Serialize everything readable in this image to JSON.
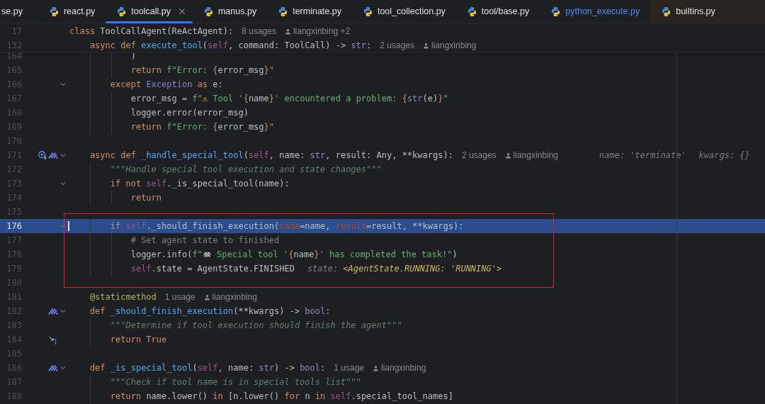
{
  "tabs": [
    {
      "label": "se.py",
      "kind": "project",
      "selected": false,
      "cut": true
    },
    {
      "label": "react.py",
      "kind": "project",
      "selected": false,
      "cut": false
    },
    {
      "label": "toolcall.py",
      "kind": "project",
      "selected": true,
      "cut": false
    },
    {
      "label": "manus.py",
      "kind": "project",
      "selected": false,
      "cut": false
    },
    {
      "label": "terminate.py",
      "kind": "project",
      "selected": false,
      "cut": false
    },
    {
      "label": "tool_collection.py",
      "kind": "project",
      "selected": false,
      "cut": false
    },
    {
      "label": "tool/base.py",
      "kind": "project",
      "selected": false,
      "cut": false
    },
    {
      "label": "python_execute.py",
      "kind": "changed",
      "selected": false,
      "cut": false
    },
    {
      "label": "builtins.py",
      "kind": "library",
      "selected": false,
      "cut": false
    }
  ],
  "sticky_lines": [
    {
      "number": "17",
      "tokens": [
        {
          "kind": "kw",
          "text": "class "
        },
        {
          "kind": "plain",
          "text": "ToolCallAgent(ReActAgent):"
        }
      ],
      "hints": [
        {
          "kind": "usages",
          "text": "8 usages"
        },
        {
          "kind": "author",
          "text": "liangxinbing +2"
        }
      ]
    },
    {
      "number": "132",
      "tokens": [
        {
          "kind": "kw",
          "text": "    async def "
        },
        {
          "kind": "fn",
          "text": "execute_tool"
        },
        {
          "kind": "plain",
          "text": "("
        },
        {
          "kind": "self",
          "text": "self"
        },
        {
          "kind": "plain",
          "text": ", command: ToolCall) -> "
        },
        {
          "kind": "builtin",
          "text": "str"
        },
        {
          "kind": "plain",
          "text": ":"
        }
      ],
      "hints": [
        {
          "kind": "usages",
          "text": "2 usages"
        },
        {
          "kind": "author",
          "text": "liangxinbing"
        }
      ]
    }
  ],
  "annotations": [
    {
      "kind": "rectangle"
    }
  ],
  "lines": [
    {
      "number": "164",
      "fold": false,
      "selected": false,
      "tokens": [
        {
          "kind": "plain",
          "text": "            )"
        }
      ]
    },
    {
      "number": "165",
      "fold": false,
      "selected": false,
      "tokens": [
        {
          "kind": "kw",
          "text": "            return "
        },
        {
          "kind": "str",
          "text": "f\"Error: "
        },
        {
          "kind": "fmt",
          "text": "{"
        },
        {
          "kind": "plain",
          "text": "error_msg"
        },
        {
          "kind": "fmt",
          "text": "}"
        },
        {
          "kind": "str",
          "text": "\""
        }
      ]
    },
    {
      "number": "166",
      "fold": true,
      "selected": false,
      "tokens": [
        {
          "kind": "kw",
          "text": "        except "
        },
        {
          "kind": "builtin",
          "text": "Exception"
        },
        {
          "kind": "kw",
          "text": " as "
        },
        {
          "kind": "plain",
          "text": "e:"
        }
      ]
    },
    {
      "number": "167",
      "fold": false,
      "selected": false,
      "tokens": [
        {
          "kind": "plain",
          "text": "            error_msg = "
        },
        {
          "kind": "str",
          "text": "f\""
        },
        {
          "kind": "warn",
          "text": "⚠"
        },
        {
          "kind": "str",
          "text": " Tool '"
        },
        {
          "kind": "fmt",
          "text": "{"
        },
        {
          "kind": "plain",
          "text": "name"
        },
        {
          "kind": "fmt",
          "text": "}"
        },
        {
          "kind": "str",
          "text": "' encountered a problem: "
        },
        {
          "kind": "fmt",
          "text": "{"
        },
        {
          "kind": "builtin",
          "text": "str"
        },
        {
          "kind": "plain",
          "text": "(e)"
        },
        {
          "kind": "fmt",
          "text": "}"
        },
        {
          "kind": "str",
          "text": "\""
        }
      ]
    },
    {
      "number": "168",
      "fold": false,
      "selected": false,
      "tokens": [
        {
          "kind": "plain",
          "text": "            logger.error(error_msg)"
        }
      ]
    },
    {
      "number": "169",
      "fold": false,
      "selected": false,
      "tokens": [
        {
          "kind": "kw",
          "text": "            return "
        },
        {
          "kind": "str",
          "text": "f\"Error: "
        },
        {
          "kind": "fmt",
          "text": "{"
        },
        {
          "kind": "plain",
          "text": "error_msg"
        },
        {
          "kind": "fmt",
          "text": "}"
        },
        {
          "kind": "str",
          "text": "\""
        }
      ]
    },
    {
      "number": "170",
      "fold": false,
      "selected": false
    },
    {
      "number": "171",
      "fold": true,
      "selected": false,
      "gutter": [
        {
          "kind": "implemented"
        },
        {
          "kind": "ai"
        }
      ],
      "tokens": [
        {
          "kind": "kw",
          "text": "    async def "
        },
        {
          "kind": "fn",
          "text": "_handle_special_tool"
        },
        {
          "kind": "plain",
          "text": "("
        },
        {
          "kind": "self",
          "text": "self"
        },
        {
          "kind": "plain",
          "text": ", name: "
        },
        {
          "kind": "builtin",
          "text": "str"
        },
        {
          "kind": "plain",
          "text": ", result: Any, **kwargs):"
        }
      ],
      "hints": [
        {
          "kind": "usages",
          "text": "2 usages"
        },
        {
          "kind": "author",
          "text": "liangxinbing"
        },
        {
          "kind": "debug",
          "label": "name:",
          "value": "'terminate'",
          "changed": false
        },
        {
          "kind": "debug",
          "label": "kwargs:",
          "value": "{}",
          "changed": false
        }
      ]
    },
    {
      "number": "172",
      "fold": false,
      "selected": false,
      "tokens": [
        {
          "kind": "doc",
          "text": "        \"\"\"Handle special tool execution and state changes\"\"\""
        }
      ]
    },
    {
      "number": "173",
      "fold": true,
      "selected": false,
      "tokens": [
        {
          "kind": "kw",
          "text": "        if not "
        },
        {
          "kind": "self",
          "text": "self"
        },
        {
          "kind": "plain",
          "text": "._is_special_tool(name):"
        }
      ]
    },
    {
      "number": "174",
      "fold": false,
      "selected": false,
      "tokens": [
        {
          "kind": "kw",
          "text": "            return"
        }
      ]
    },
    {
      "number": "175",
      "fold": false,
      "selected": false
    },
    {
      "number": "176",
      "fold": true,
      "selected": true,
      "tokens": [
        {
          "kind": "kw",
          "text": "        if "
        },
        {
          "kind": "self",
          "text": "self"
        },
        {
          "kind": "plain",
          "text": "._should_finish_execution("
        },
        {
          "kind": "kwarg",
          "text": "name"
        },
        {
          "kind": "plain",
          "text": "=name, "
        },
        {
          "kind": "kwarg",
          "text": "result"
        },
        {
          "kind": "plain",
          "text": "=result, **kwargs):"
        }
      ]
    },
    {
      "number": "177",
      "fold": false,
      "selected": false,
      "tokens": [
        {
          "kind": "comment",
          "text": "            # Set agent state to finished"
        }
      ]
    },
    {
      "number": "178",
      "fold": false,
      "selected": false,
      "tokens": [
        {
          "kind": "plain",
          "text": "            logger.info("
        },
        {
          "kind": "str",
          "text": "f\""
        },
        {
          "kind": "flag"
        },
        {
          "kind": "str",
          "text": " Special tool '"
        },
        {
          "kind": "fmt",
          "text": "{"
        },
        {
          "kind": "plain",
          "text": "name"
        },
        {
          "kind": "fmt",
          "text": "}"
        },
        {
          "kind": "str",
          "text": "' has completed the task!\""
        },
        {
          "kind": "plain",
          "text": ")"
        }
      ]
    },
    {
      "number": "179",
      "fold": false,
      "selected": false,
      "tokens": [
        {
          "kind": "self",
          "text": "            self"
        },
        {
          "kind": "plain",
          "text": ".state = AgentState.FINISHED"
        }
      ],
      "hints": [
        {
          "kind": "debug",
          "label": "state:",
          "value": "<AgentState.RUNNING: 'RUNNING'>",
          "changed": true
        }
      ]
    },
    {
      "number": "180",
      "fold": false,
      "selected": false
    },
    {
      "number": "181",
      "fold": false,
      "selected": false,
      "tokens": [
        {
          "kind": "deco",
          "text": "    @staticmethod"
        }
      ],
      "hints": [
        {
          "kind": "usages",
          "text": "1 usage"
        },
        {
          "kind": "author",
          "text": "liangxinbing"
        }
      ]
    },
    {
      "number": "182",
      "fold": true,
      "selected": false,
      "gutter": [
        {
          "kind": "ai"
        }
      ],
      "tokens": [
        {
          "kind": "kw",
          "text": "    def "
        },
        {
          "kind": "fn",
          "text": "_should_finish_execution"
        },
        {
          "kind": "plain",
          "text": "(**kwargs) -> "
        },
        {
          "kind": "builtin",
          "text": "bool"
        },
        {
          "kind": "plain",
          "text": ":"
        }
      ]
    },
    {
      "number": "183",
      "fold": false,
      "selected": false,
      "tokens": [
        {
          "kind": "doc",
          "text": "        \"\"\"Determine if tool execution should finish the agent\"\"\""
        }
      ]
    },
    {
      "number": "184",
      "fold": false,
      "selected": false,
      "gutter": [
        {
          "kind": "step-into"
        }
      ],
      "tokens": [
        {
          "kind": "kw",
          "text": "        return True"
        }
      ]
    },
    {
      "number": "185",
      "fold": false,
      "selected": false
    },
    {
      "number": "186",
      "fold": true,
      "selected": false,
      "gutter": [
        {
          "kind": "ai"
        }
      ],
      "tokens": [
        {
          "kind": "kw",
          "text": "    def "
        },
        {
          "kind": "fn",
          "text": "_is_special_tool"
        },
        {
          "kind": "plain",
          "text": "("
        },
        {
          "kind": "self",
          "text": "self"
        },
        {
          "kind": "plain",
          "text": ", name: "
        },
        {
          "kind": "builtin",
          "text": "str"
        },
        {
          "kind": "plain",
          "text": ") -> "
        },
        {
          "kind": "builtin",
          "text": "bool"
        },
        {
          "kind": "plain",
          "text": ":"
        }
      ],
      "hints": [
        {
          "kind": "usages",
          "text": "1 usage"
        },
        {
          "kind": "author",
          "text": "liangxinbing"
        }
      ]
    },
    {
      "number": "187",
      "fold": false,
      "selected": false,
      "tokens": [
        {
          "kind": "doc",
          "text": "        \"\"\"Check if tool name is in special tools list\"\"\""
        }
      ]
    },
    {
      "number": "188",
      "fold": false,
      "selected": false,
      "tokens": [
        {
          "kind": "kw",
          "text": "        return"
        },
        {
          "kind": "plain",
          "text": " name.lower() "
        },
        {
          "kind": "kw",
          "text": "in"
        },
        {
          "kind": "plain",
          "text": " [n.lower() "
        },
        {
          "kind": "kw",
          "text": "for"
        },
        {
          "kind": "plain",
          "text": " n "
        },
        {
          "kind": "kw",
          "text": "in "
        },
        {
          "kind": "self",
          "text": "self"
        },
        {
          "kind": "plain",
          "text": ".special_tool_names]"
        }
      ]
    }
  ]
}
